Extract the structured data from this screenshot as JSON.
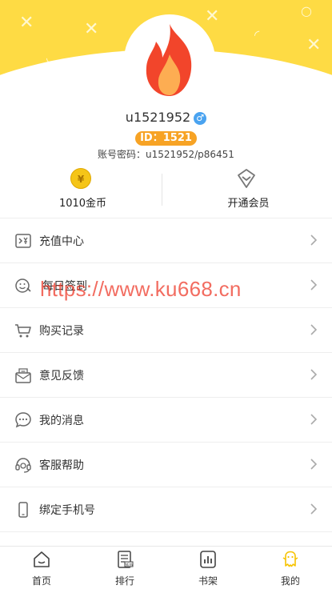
{
  "profile": {
    "username": "u1521952",
    "gender_icon": "male",
    "gender_symbol": "♂",
    "id_badge": "ID：1521",
    "account": "账号密码：u1521952/p86451"
  },
  "stats": {
    "coins_label": "1010金币",
    "coin_symbol": "¥",
    "vip_label": "开通会员"
  },
  "menu": [
    {
      "label": "充值中心",
      "icon": "recharge-icon"
    },
    {
      "label": "每日签到",
      "icon": "checkin-icon"
    },
    {
      "label": "购买记录",
      "icon": "cart-icon"
    },
    {
      "label": "意见反馈",
      "icon": "feedback-icon"
    },
    {
      "label": "我的消息",
      "icon": "message-icon"
    },
    {
      "label": "客服帮助",
      "icon": "headset-icon"
    },
    {
      "label": "绑定手机号",
      "icon": "phone-icon"
    }
  ],
  "watermark": "https://www.ku668.cn",
  "tabs": [
    {
      "label": "首页",
      "icon": "home-icon"
    },
    {
      "label": "排行",
      "icon": "ranking-icon"
    },
    {
      "label": "书架",
      "icon": "bookshelf-icon"
    },
    {
      "label": "我的",
      "icon": "mine-icon",
      "active": true
    }
  ],
  "colors": {
    "header": "#fedb44",
    "badge": "#f7a325",
    "active_tab": "#f7c300",
    "flame": "#f2452b"
  }
}
